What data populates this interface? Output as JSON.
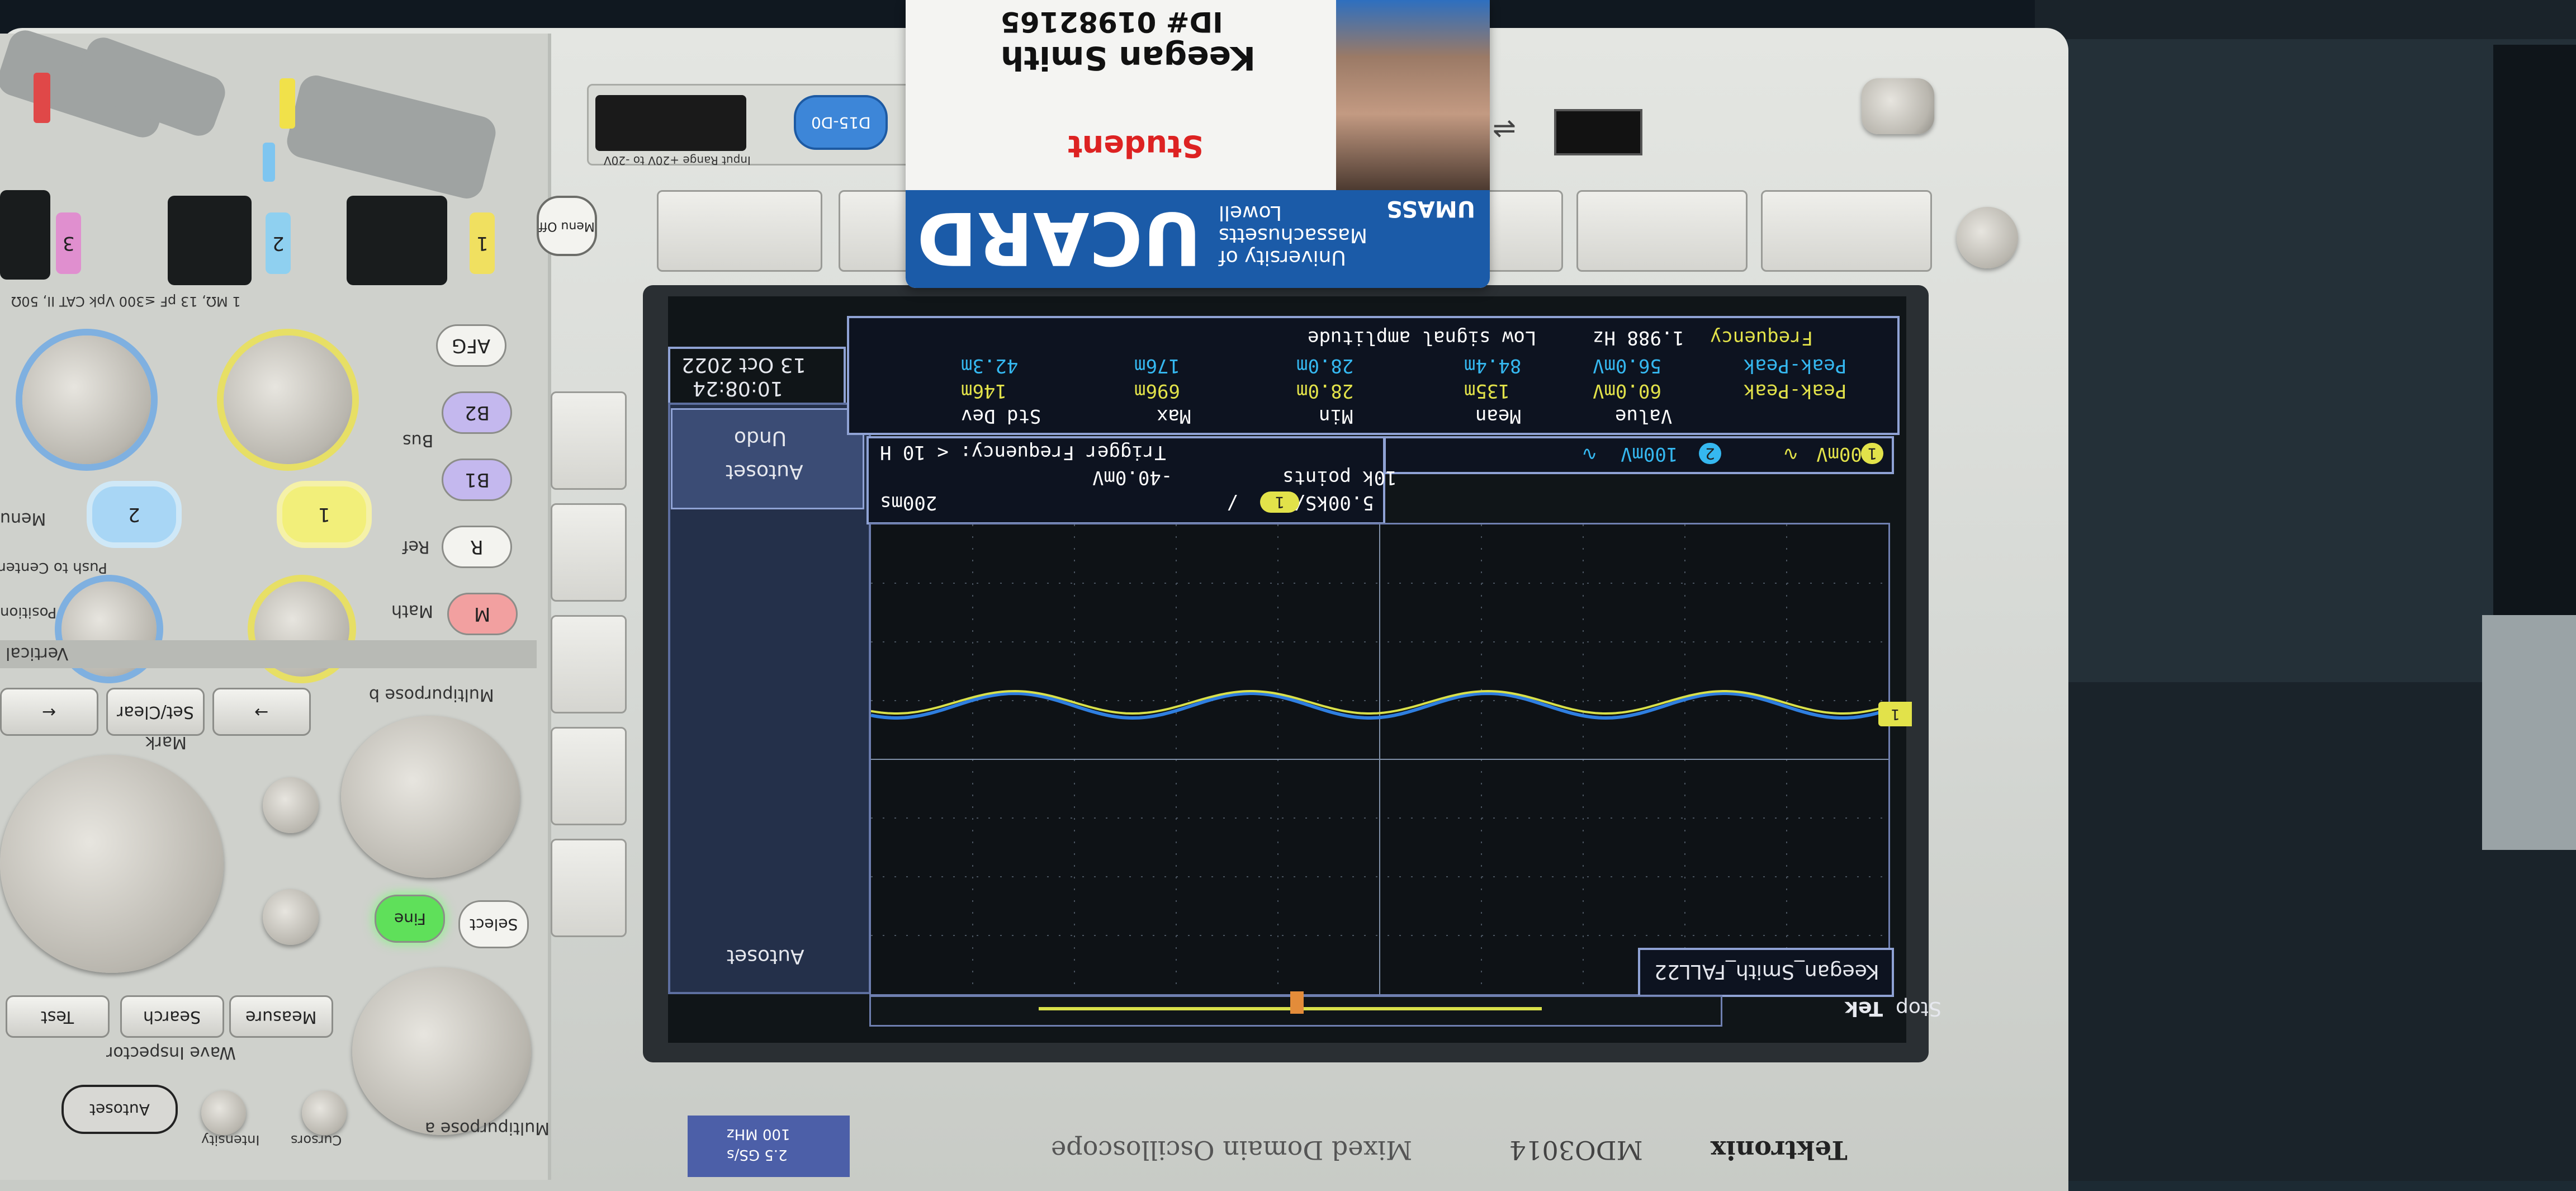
{
  "card": {
    "school_line1": "University of",
    "school_line2": "Massachusetts",
    "school_line3": "Lowell",
    "logo_text": "UMASS",
    "ucard": "UCARD",
    "role": "Student",
    "name": "Keegan Smith",
    "id": "ID# 01982165"
  },
  "connector": {
    "label": "D15-D0",
    "range_note": "Input Range +20V to -20V"
  },
  "panel_labels": {
    "menu_off": "Menu Off",
    "afg": "AFG",
    "b2": "B2",
    "b1": "B1",
    "bus": "Bus",
    "ref": "R",
    "ref_label": "Ref",
    "math": "M",
    "math_label": "Math",
    "menu": "Menu",
    "vertical": "Vertical",
    "position": "Position",
    "push_to_center": "Push to Center",
    "ch1": "1",
    "ch2": "2",
    "ch3": "3",
    "ch_sel_1": "1",
    "ch_sel_2": "2",
    "probe_spec": "1 MΩ, 13 pF ≤300 Vpk CAT II, 50Ω",
    "multipurpose_b": "Multipurpose b",
    "multipurpose_a": "Multipurpose a",
    "set_clear": "Set/Clear",
    "mark": "Mark",
    "fine": "Fine",
    "select": "Select",
    "measure": "Measure",
    "search": "Search",
    "test": "Test",
    "wave_inspector": "Wave Inspector",
    "autoset": "Autoset",
    "intensity": "Intensity",
    "cursors": "Cursors"
  },
  "screen": {
    "datetime_date": "13 Oct 2022",
    "datetime_time": "10:08:24",
    "menu_undo": "Undo",
    "menu_undo_sub": "Autoset",
    "menu_autoset": "Autoset",
    "measurements": {
      "headers": [
        "Value",
        "Mean",
        "Min",
        "Max",
        "Std Dev"
      ],
      "rows": [
        {
          "ch": "1",
          "name": "Frequency",
          "value": "1.988 Hz",
          "note": "Low signal amplitude",
          "color": "#e2e24a"
        },
        {
          "ch": "2",
          "name": "Peak-Peak",
          "value": "56.0mV",
          "mean": "84.4m",
          "min": "28.0m",
          "max": "176m",
          "std": "42.3m",
          "color": "#35b8f0"
        },
        {
          "ch": "1",
          "name": "Peak-Peak",
          "value": "60.0mV",
          "mean": "135m",
          "min": "28.0m",
          "max": "696m",
          "std": "146m",
          "color": "#e2e24a"
        }
      ]
    },
    "channels": {
      "ch1_num": "1",
      "ch1_scale": "100mV",
      "ch1_coupling": "∿",
      "ch2_num": "2",
      "ch2_scale": "100mV",
      "ch2_coupling": "∿"
    },
    "trigger": {
      "timebase": "200ms",
      "sample_rate": "5.00kS/s",
      "record_length": "10k points",
      "trig_ch": "1",
      "trig_slope": "/",
      "trig_level": "-40.0mV",
      "trig_freq": "Trigger Frequency: < 10 H"
    },
    "label": "Keegan_Smith_FALL22",
    "brand": "Tek",
    "run_state": "Stop",
    "ch_marker": "1",
    "trace_colors": {
      "ch1": "#d8e04a",
      "ch2": "#2f7fe0"
    }
  },
  "branding": {
    "maker": "Tektronix",
    "model": "MDO3014",
    "product": "Mixed Domain Oscilloscope",
    "spec1": "100 MHz",
    "spec2": "2.5 GS/s"
  }
}
